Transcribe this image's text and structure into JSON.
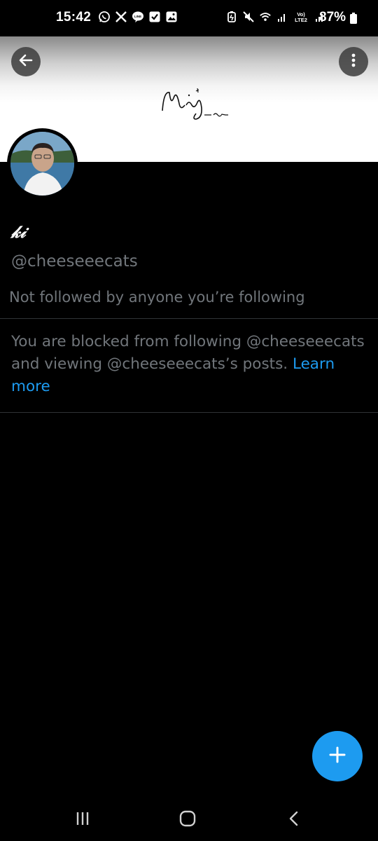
{
  "status_bar": {
    "time": "15:42",
    "battery": "87%",
    "left_icons": [
      "whatsapp-icon",
      "x-icon",
      "line-icon",
      "checkbox-icon",
      "gallery-icon"
    ],
    "right_icons": [
      "battery-saver-icon",
      "mute-icon",
      "wifi-icon",
      "signal-icon",
      "volte-icon",
      "signal-icon",
      "battery-icon"
    ],
    "volte_label": "Vo) LTE2"
  },
  "header": {
    "banner_signature_color": "#111111"
  },
  "profile": {
    "display_name": "𝓀𝒾",
    "handle": "@cheeseeecats",
    "followed_by": "Not followed by anyone you’re following",
    "blocked_message": "You are blocked from following @cheeseeecats and viewing @cheeseeecats’s posts.",
    "learn_more": "Learn more"
  },
  "colors": {
    "background": "#000000",
    "accent": "#1d9bf0",
    "secondary_text": "#71767b",
    "divider": "#2f3336"
  },
  "icons": {
    "back": "arrow-left-icon",
    "more": "more-vertical-icon",
    "compose": "plus-icon",
    "nav_recents": "recents-icon",
    "nav_home": "home-icon",
    "nav_back": "chevron-left-icon"
  }
}
